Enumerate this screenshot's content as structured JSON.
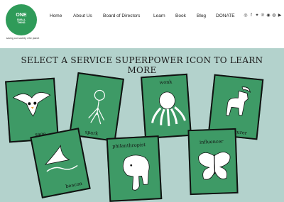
{
  "header": {
    "logo": {
      "line1": "ONE",
      "line2": "SMALL",
      "line3": "THING",
      "brand_color": "#2f9b59"
    },
    "tagline": "saving our society • the planet",
    "nav": [
      "Home",
      "About Us",
      "Board of Directors",
      "Learn",
      "Book",
      "Blog",
      "DONATE"
    ],
    "social_icons": [
      "instagram-icon",
      "facebook-icon",
      "twitter-icon",
      "pinterest-icon",
      "spotify-icon",
      "podcast-icon",
      "youtube-icon"
    ]
  },
  "main": {
    "heading_line1": "SELECT A SERVICE SUPERPOWER ICON TO LEARN",
    "heading_line2": "MORE",
    "background_color": "#b3d2cc",
    "card_color": "#3e9a66",
    "cards": [
      {
        "label": "sage",
        "icon": "owl-icon"
      },
      {
        "label": "spark",
        "icon": "lightbulb-icon"
      },
      {
        "label": "wonk",
        "icon": "octopus-icon"
      },
      {
        "label": "adventurer",
        "icon": "goat-icon"
      },
      {
        "label": "beacon",
        "icon": "shark-fin-icon"
      },
      {
        "label": "philanthropist",
        "icon": "elephant-icon"
      },
      {
        "label": "influencer",
        "icon": "butterfly-icon"
      }
    ]
  }
}
